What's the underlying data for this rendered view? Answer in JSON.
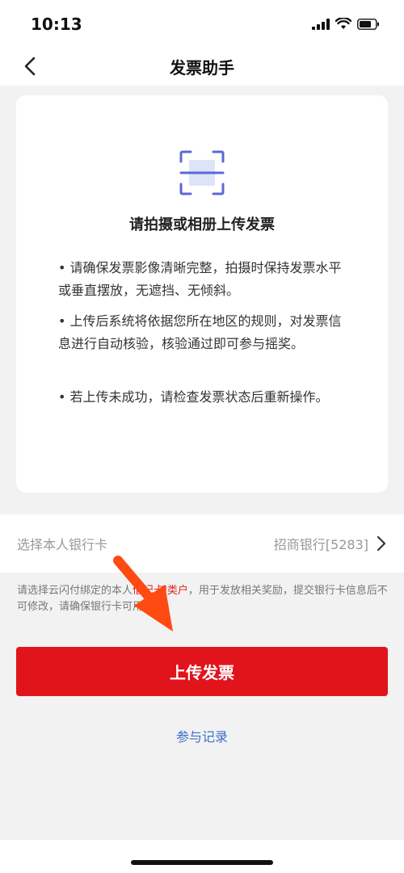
{
  "status_bar": {
    "time": "10:13",
    "icons": [
      "signal-icon",
      "wifi-icon",
      "battery-icon"
    ]
  },
  "nav": {
    "title": "发票助手",
    "back_icon": "chevron-left-icon"
  },
  "card": {
    "icon": "scan-icon",
    "title": "请拍摄或相册上传发票",
    "tips": [
      "• 请确保发票影像清晰完整，拍摄时保持发票水平或垂直摆放，无遮挡、无倾斜。",
      "• 上传后系统将依据您所在地区的规则，对发票信息进行自动核验，核验通过即可参与摇奖。",
      "• 若上传未成功，请检查发票状态后重新操作。"
    ]
  },
  "bank": {
    "label": "选择本人银行卡",
    "value": "招商银行[5283]",
    "chevron_icon": "chevron-right-icon"
  },
  "notice": {
    "part1": "请选择云闪付绑定的本人",
    "highlight": "借记卡Ⅰ类户",
    "part2": "，用于发放相关奖励，提交银行卡信息后不可修改，请确保银行卡可用。"
  },
  "upload_button": {
    "label": "上传发票"
  },
  "records_link": {
    "label": "参与记录"
  },
  "colors": {
    "primary_red": "#e1141c",
    "link_blue": "#3d6fcc",
    "scan_icon": "#5b68d8",
    "annotation_arrow": "#ff4a12"
  }
}
